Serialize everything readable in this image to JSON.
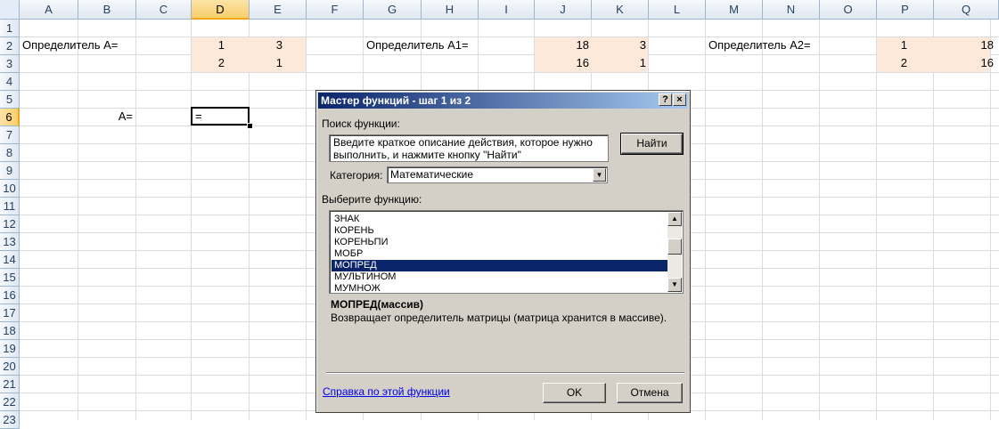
{
  "columns": [
    "A",
    "B",
    "C",
    "D",
    "E",
    "F",
    "G",
    "H",
    "I",
    "J",
    "K",
    "L",
    "M",
    "N",
    "O",
    "P",
    "Q"
  ],
  "rows": [
    "1",
    "2",
    "3",
    "4",
    "5",
    "6",
    "7",
    "8",
    "9",
    "10",
    "11",
    "12",
    "13",
    "14",
    "15",
    "16",
    "17",
    "18",
    "19",
    "20",
    "21",
    "22",
    "23"
  ],
  "cells": {
    "a2": "Определитель  A=",
    "d2": "1",
    "e2": "3",
    "d3": "2",
    "e3": "1",
    "g2": "Определитель A1=",
    "j2": "18",
    "k2": "3",
    "j3": "16",
    "k3": "1",
    "m2": "Определитель A2=",
    "p2": "1",
    "q2": "18",
    "p3": "2",
    "q3": "16",
    "b6": "A=",
    "d6": "="
  },
  "dialog": {
    "title": "Мастер функций - шаг 1 из 2",
    "help_btn": "?",
    "close_btn": "×",
    "search_label": "Поиск функции:",
    "search_text": "Введите краткое описание действия, которое нужно выполнить, и нажмите кнопку \"Найти\"",
    "find_button": "Найти",
    "category_label": "Категория:",
    "category_value": "Математические",
    "select_label": "Выберите функцию:",
    "functions": [
      "ЗНАК",
      "КОРЕНЬ",
      "КОРЕНЬПИ",
      "МОБР",
      "МОПРЕД",
      "МУЛЬТИНОМ",
      "МУМНОЖ"
    ],
    "selected_function": "МОПРЕД",
    "signature": "МОПРЕД(массив)",
    "description": "Возвращает определитель матрицы (матрица хранится в массиве).",
    "help_link": "Справка по этой функции",
    "ok_button": "OK",
    "cancel_button": "Отмена"
  },
  "colors": {
    "highlight_fill": "#fde9d9",
    "selection": "#0a246a"
  }
}
